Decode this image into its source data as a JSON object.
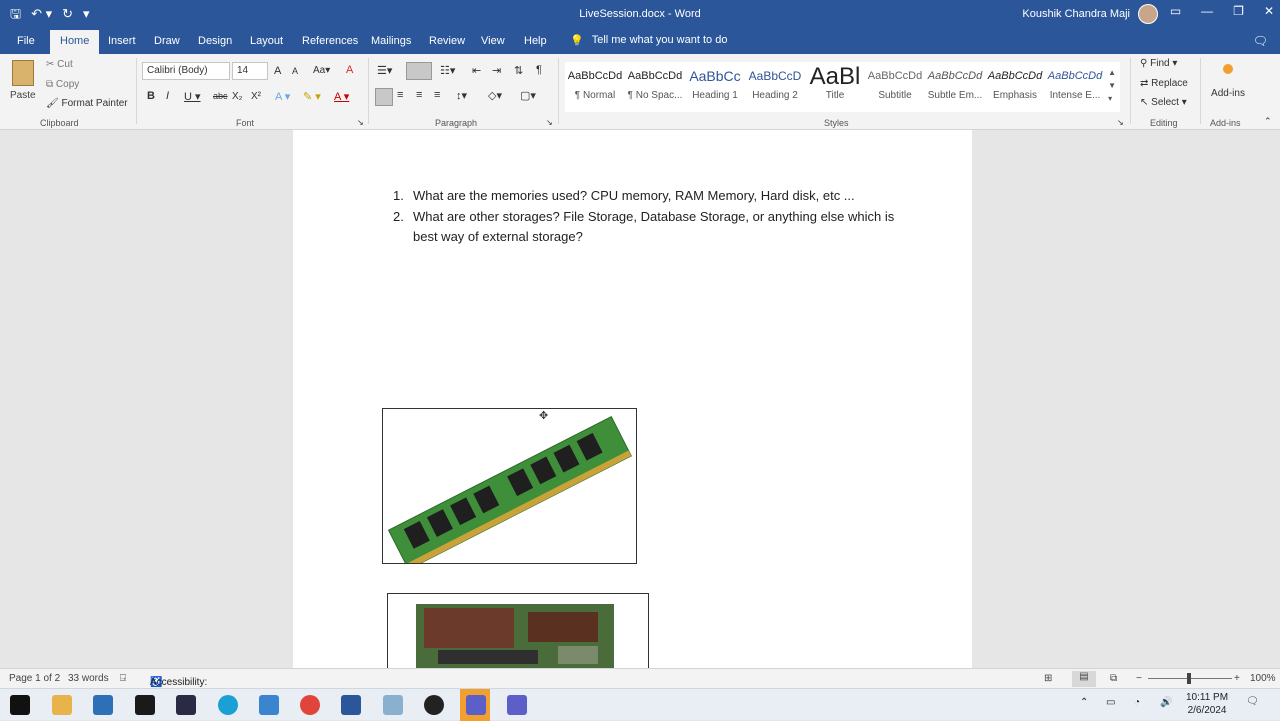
{
  "window": {
    "doc_title": "LiveSession.docx - Word",
    "user_name": "Koushik Chandra Maji"
  },
  "tabs": [
    "File",
    "Home",
    "Insert",
    "Draw",
    "Design",
    "Layout",
    "References",
    "Mailings",
    "Review",
    "View",
    "Help"
  ],
  "tell_me": "Tell me what you want to do",
  "clipboard": {
    "paste": "Paste",
    "cut": "Cut",
    "copy": "Copy",
    "format_painter": "Format Painter",
    "group_label": "Clipboard"
  },
  "font": {
    "name": "Calibri (Body)",
    "size": "14",
    "group_label": "Font"
  },
  "paragraph": {
    "group_label": "Paragraph"
  },
  "styles": {
    "group_label": "Styles",
    "items": [
      {
        "preview": "AaBbCcDd",
        "name": "¶ Normal"
      },
      {
        "preview": "AaBbCcDd",
        "name": "¶ No Spac..."
      },
      {
        "preview": "AaBbCc",
        "name": "Heading 1"
      },
      {
        "preview": "AaBbCcD",
        "name": "Heading 2"
      },
      {
        "preview": "AaBl",
        "name": "Title"
      },
      {
        "preview": "AaBbCcDd",
        "name": "Subtitle"
      },
      {
        "preview": "AaBbCcDd",
        "name": "Subtle Em..."
      },
      {
        "preview": "AaBbCcDd",
        "name": "Emphasis"
      },
      {
        "preview": "AaBbCcDd",
        "name": "Intense E..."
      }
    ]
  },
  "editing": {
    "find": "Find",
    "replace": "Replace",
    "select": "Select",
    "group_label": "Editing"
  },
  "addins": {
    "label": "Add-ins",
    "group_label": "Add-ins"
  },
  "document": {
    "items": [
      {
        "num": "1.",
        "text": "What are the memories used? CPU memory, RAM Memory, Hard disk, etc ..."
      },
      {
        "num": "2.",
        "text": "What are other storages? File Storage, Database Storage, or anything else which is best way of external storage?"
      }
    ]
  },
  "status": {
    "page": "Page 1 of 2",
    "words": "33 words",
    "accessibility": "Accessibility: Investigate",
    "zoom": "100%"
  },
  "clock": {
    "time": "10:11 PM",
    "date": "2/6/2024"
  },
  "colors": {
    "word_blue": "#2b579a",
    "ram_green": "#3f8f3a"
  }
}
